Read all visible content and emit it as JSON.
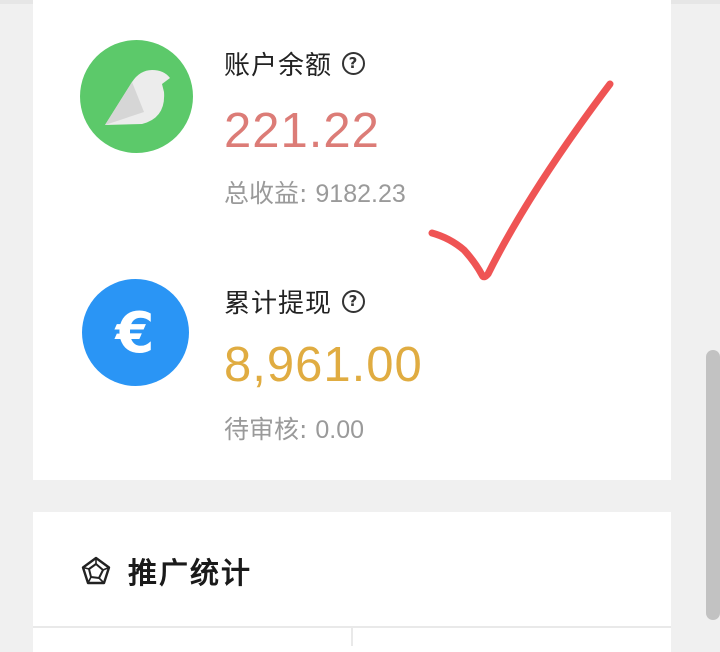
{
  "balance": {
    "label": "账户余额",
    "help_icon": "question-circle-icon",
    "amount": "221.22",
    "sub_label": "总收益:",
    "sub_value": "9182.23",
    "icon": "bird-icon",
    "amount_color": "#dc7c77",
    "icon_color": "#5cc96a"
  },
  "withdrawal": {
    "label": "累计提现",
    "help_icon": "question-circle-icon",
    "amount": "8,961.00",
    "sub_label": "待审核:",
    "sub_value": "0.00",
    "icon": "euro-icon",
    "amount_color": "#e0ac41",
    "icon_color": "#2a95f5"
  },
  "stats": {
    "title": "推广统计",
    "icon": "pentagon-radar-icon"
  },
  "annotation": {
    "icon": "red-checkmark-icon",
    "color": "#ef5454"
  }
}
